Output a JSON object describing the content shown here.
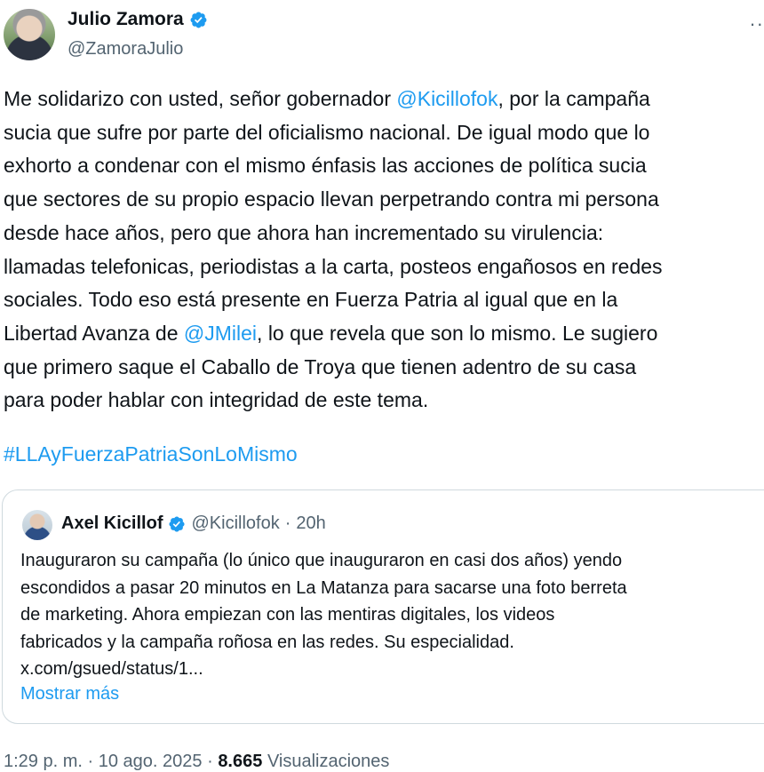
{
  "author": {
    "name": "Julio Zamora",
    "handle": "@ZamoraJulio"
  },
  "tweet": {
    "lines": [
      [
        {
          "t": "Me solidarizo con usted, señor gobernador "
        },
        {
          "t": "@Kicillofok",
          "link": true
        },
        {
          "t": ", por la campaña"
        }
      ],
      [
        {
          "t": "sucia que sufre por parte del oficialismo nacional. De igual modo que lo"
        }
      ],
      [
        {
          "t": "exhorto a condenar con el mismo énfasis las acciones de política sucia"
        }
      ],
      [
        {
          "t": "que sectores de su propio espacio llevan perpetrando contra mi persona"
        }
      ],
      [
        {
          "t": "desde hace años, pero que ahora han incrementado su virulencia:"
        }
      ],
      [
        {
          "t": "llamadas telefonicas, periodistas a la carta, posteos engañosos en redes"
        }
      ],
      [
        {
          "t": "sociales. Todo eso está presente en Fuerza Patria al igual que en la"
        }
      ],
      [
        {
          "t": "Libertad Avanza de "
        },
        {
          "t": "@JMilei",
          "link": true
        },
        {
          "t": ", lo que revela que son lo mismo. Le sugiero"
        }
      ],
      [
        {
          "t": "que primero saque el Caballo de Troya que tienen adentro de su casa"
        }
      ],
      [
        {
          "t": "para poder hablar con integridad de este tema."
        }
      ]
    ],
    "hashtag": "#LLAyFuerzaPatriaSonLoMismo"
  },
  "quote": {
    "name": "Axel Kicillof",
    "handle": "@Kicillofok",
    "separator": "·",
    "time": "20h",
    "lines": [
      "Inauguraron su campaña (lo único que inauguraron en casi dos años) yendo",
      "escondidos a pasar 20 minutos en La Matanza para sacarse una foto berreta",
      "de marketing. Ahora empiezan con las mentiras digitales, los videos",
      "fabricados y la campaña roñosa en las redes. Su especialidad.",
      "x.com/gsued/status/1..."
    ],
    "show_more": "Mostrar más"
  },
  "meta": {
    "time": "1:29 p. m.",
    "separator": "·",
    "date": "10 ago. 2025",
    "views_count": "8.665",
    "views_label": "Visualizaciones"
  },
  "colors": {
    "link": "#1d9bf0",
    "text": "#0f1419",
    "muted": "#536471",
    "verified": "#1d9bf0",
    "border": "#cfd9de"
  },
  "icons": {
    "verified": "verified-badge-icon",
    "more": "more-horizontal-icon"
  }
}
